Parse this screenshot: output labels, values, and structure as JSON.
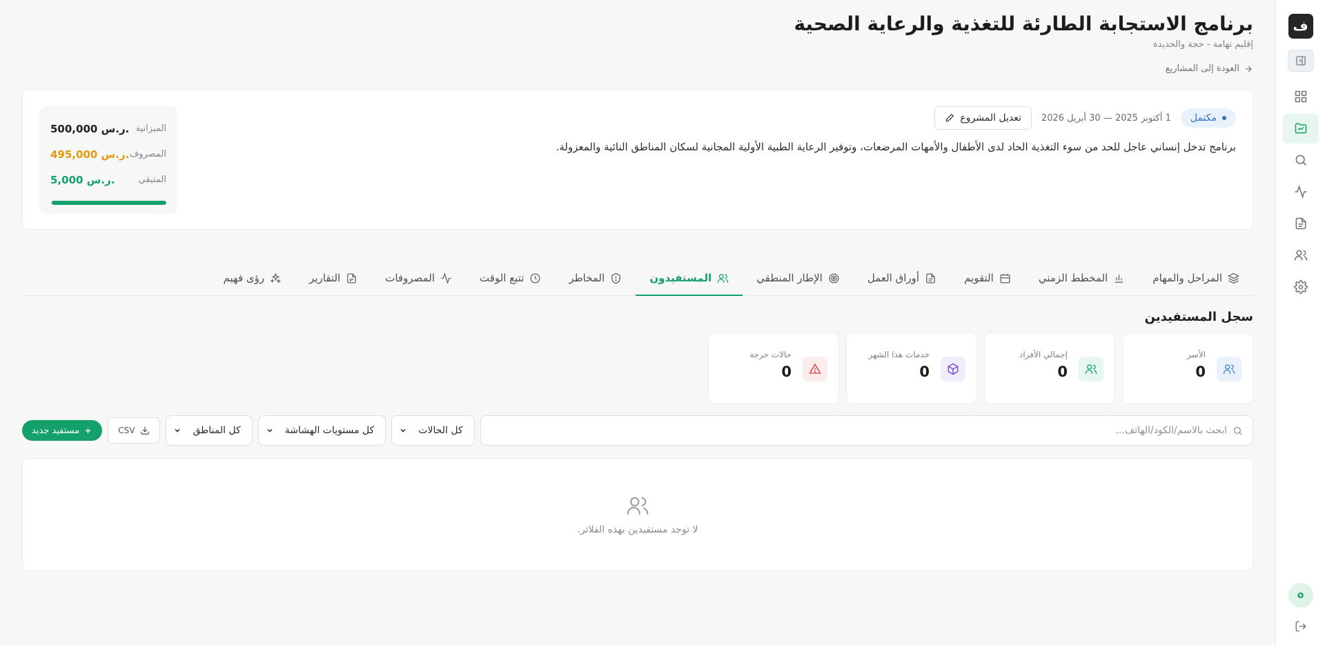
{
  "app": {
    "logo_glyph": "ف",
    "avatar_letter": "o"
  },
  "sidebar": {
    "items": [
      {
        "name": "dashboard",
        "icon": "grid-icon",
        "active": false
      },
      {
        "name": "projects",
        "icon": "folder-chart-icon",
        "active": true
      },
      {
        "name": "search",
        "icon": "search-icon",
        "active": false
      },
      {
        "name": "activity",
        "icon": "activity-icon",
        "active": false
      },
      {
        "name": "documents",
        "icon": "document-icon",
        "active": false
      },
      {
        "name": "users",
        "icon": "users-icon",
        "active": false
      },
      {
        "name": "settings",
        "icon": "gear-icon",
        "active": false
      }
    ]
  },
  "header": {
    "title": "برنامج الاستجابة الطارئة للتغذية والرعاية الصحية",
    "subtitle": "إقليم تهامة - حجة والحديدة",
    "back_label": "العودة إلى المشاريع"
  },
  "project": {
    "status": "مكتمل",
    "date_range": "1 أكتوبر 2025 — 30 أبريل 2026",
    "edit_label": "تعديل المشروع",
    "description": "برنامج تدخل إنساني عاجل للحد من سوء التغذية الحاد لدى الأطفال والأمهات المرضعات، وتوفير الرعاية الطبية الأولية المجانية لسكان المناطق النائية والمعزولة.",
    "budget": {
      "budget_label": "الميزانية",
      "budget_value": "500,000 ر.س.",
      "spent_label": "المصروف",
      "spent_value": "495,000 ر.س.",
      "remaining_label": "المتبقي",
      "remaining_value": "5,000 ر.س.",
      "progress_fraction": 0.99
    }
  },
  "tabs": [
    {
      "label": "المراحل والمهام",
      "icon": "layers-icon",
      "active": false
    },
    {
      "label": "المخطط الزمني",
      "icon": "bar-chart-icon",
      "active": false
    },
    {
      "label": "التقويم",
      "icon": "calendar-icon",
      "active": false
    },
    {
      "label": "أوراق العمل",
      "icon": "document-icon",
      "active": false
    },
    {
      "label": "الإطار المنطقي",
      "icon": "target-icon",
      "active": false
    },
    {
      "label": "المستفيدون",
      "icon": "users-icon",
      "active": true
    },
    {
      "label": "المخاطر",
      "icon": "shield-icon",
      "active": false
    },
    {
      "label": "تتبع الوقت",
      "icon": "clock-icon",
      "active": false
    },
    {
      "label": "المصروفات",
      "icon": "activity-icon",
      "active": false
    },
    {
      "label": "التقارير",
      "icon": "report-icon",
      "active": false
    },
    {
      "label": "رؤى فهيم",
      "icon": "sparkles-icon",
      "active": false
    }
  ],
  "beneficiaries": {
    "section_title": "سجل المستفيدين",
    "stats": [
      {
        "label": "الأسر",
        "value": "0",
        "icon": "users-icon",
        "color": "#3b7dd8"
      },
      {
        "label": "إجمالي الأفراد",
        "value": "0",
        "icon": "users-icon",
        "color": "#14a06a"
      },
      {
        "label": "خدمات هذا الشهر",
        "value": "0",
        "icon": "package-icon",
        "color": "#7446d1"
      },
      {
        "label": "حالات حرجة",
        "value": "0",
        "icon": "alert-triangle-icon",
        "color": "#d63f3f"
      }
    ],
    "search_placeholder": "ابحث بالاسم/الكود/الهاتف...",
    "filters": {
      "status": "كل الحالات",
      "vulnerability": "كل مستويات الهشاشة",
      "regions": "كل المناطق"
    },
    "csv_label": "CSV",
    "new_label": "مستفيد جديد",
    "empty_text": "لا توجد مستفيدين بهذه الفلاتر."
  }
}
